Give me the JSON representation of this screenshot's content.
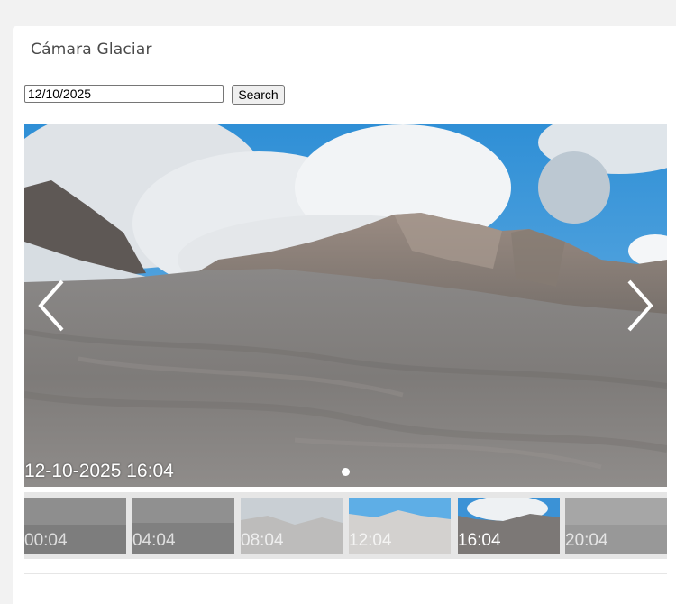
{
  "widget": {
    "title": "Cámara Glaciar"
  },
  "search": {
    "date_value": "12/10/2025",
    "button_label": "Search"
  },
  "viewer": {
    "timestamp": "12-10-2025 16:04",
    "prev_icon": "chevron-left-icon",
    "next_icon": "chevron-right-icon"
  },
  "thumbnails": [
    {
      "time": "00:04"
    },
    {
      "time": "04:04"
    },
    {
      "time": "08:04"
    },
    {
      "time": "12:04"
    },
    {
      "time": "16:04"
    },
    {
      "time": "20:04"
    }
  ]
}
